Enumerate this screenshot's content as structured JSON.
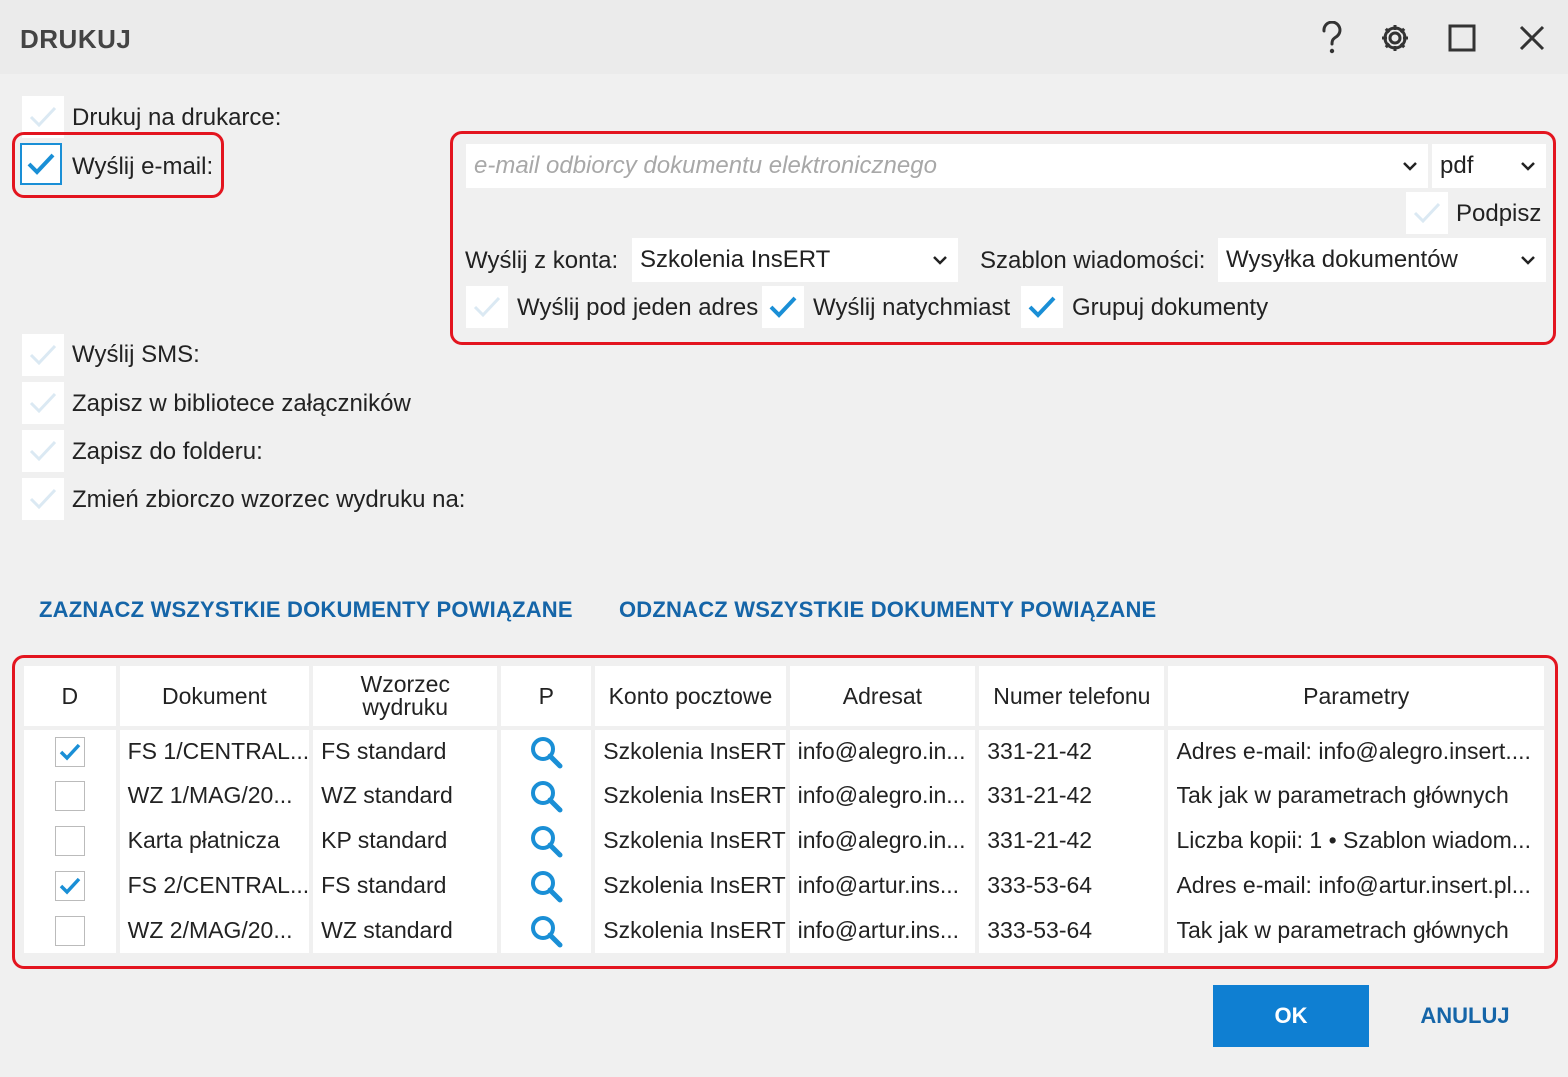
{
  "window": {
    "title": "DRUKUJ",
    "help_icon": "help-icon",
    "settings_icon": "gear-icon",
    "maximize_icon": "maximize-icon",
    "close_icon": "close-icon"
  },
  "options": {
    "print": {
      "label": "Drukuj na drukarce:",
      "checked": false
    },
    "email": {
      "label": "Wyślij e-mail:",
      "checked": true
    },
    "sms": {
      "label": "Wyślij SMS:",
      "checked": false
    },
    "library": {
      "label": "Zapisz w bibliotece załączników",
      "checked": false
    },
    "folder": {
      "label": "Zapisz do folderu:",
      "checked": false
    },
    "template": {
      "label": "Zmień zbiorczo wzorzec wydruku na:",
      "checked": false
    }
  },
  "email_panel": {
    "recipient_placeholder": "e-mail odbiorcy dokumentu elektronicznego",
    "format": "pdf",
    "sign_label": "Podpisz",
    "sign_checked": false,
    "account_label": "Wyślij z konta:",
    "account_value": "Szkolenia InsERT",
    "template_label": "Szablon wiadomości:",
    "template_value": "Wysyłka dokumentów",
    "single_address_label": "Wyślij pod jeden adres",
    "single_address_checked": false,
    "send_now_label": "Wyślij natychmiast",
    "send_now_checked": true,
    "group_label": "Grupuj dokumenty",
    "group_checked": true
  },
  "links": {
    "select_all": "ZAZNACZ WSZYSTKIE DOKUMENTY POWIĄZANE",
    "deselect_all": "ODZNACZ WSZYSTKIE DOKUMENTY POWIĄZANE"
  },
  "table": {
    "headers": {
      "d": "D",
      "document": "Dokument",
      "template_line1": "Wzorzec",
      "template_line2": "wydruku",
      "p": "P",
      "account": "Konto pocztowe",
      "recipient": "Adresat",
      "phone": "Numer telefonu",
      "params": "Parametry"
    },
    "rows": [
      {
        "checked": true,
        "document": "FS 1/CENTRAL...",
        "template": "FS standard",
        "account": "Szkolenia InsERT",
        "recipient": "info@alegro.in...",
        "phone": "331-21-42",
        "params": "Adres e-mail: info@alegro.insert...."
      },
      {
        "checked": false,
        "document": "WZ 1/MAG/20...",
        "template": "WZ standard",
        "account": "Szkolenia InsERT",
        "recipient": "info@alegro.in...",
        "phone": "331-21-42",
        "params": "Tak jak w parametrach głównych"
      },
      {
        "checked": false,
        "document": "Karta płatnicza",
        "template": "KP standard",
        "account": "Szkolenia InsERT",
        "recipient": "info@alegro.in...",
        "phone": "331-21-42",
        "params": "Liczba kopii: 1 • Szablon wiadom..."
      },
      {
        "checked": true,
        "document": "FS 2/CENTRAL...",
        "template": "FS standard",
        "account": "Szkolenia InsERT",
        "recipient": "info@artur.ins...",
        "phone": "333-53-64",
        "params": "Adres e-mail: info@artur.insert.pl..."
      },
      {
        "checked": false,
        "document": "WZ 2/MAG/20...",
        "template": "WZ standard",
        "account": "Szkolenia InsERT",
        "recipient": "info@artur.ins...",
        "phone": "333-53-64",
        "params": "Tak jak w parametrach głównych"
      }
    ]
  },
  "buttons": {
    "ok": "OK",
    "cancel": "ANULUJ"
  },
  "colors": {
    "accent": "#1a8fd6",
    "link": "#1565a8",
    "highlight": "#e3151f",
    "primary_button": "#0f7fd2"
  }
}
